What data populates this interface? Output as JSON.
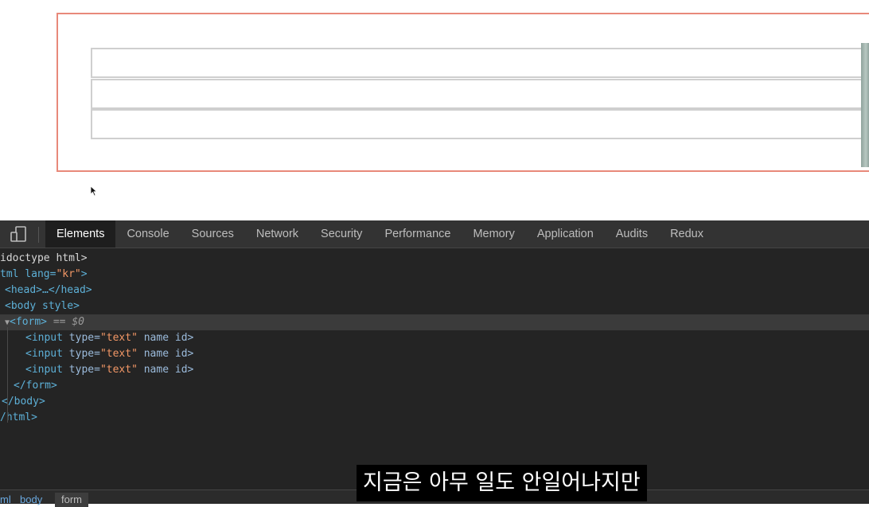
{
  "devtools": {
    "tabs": [
      "Elements",
      "Console",
      "Sources",
      "Network",
      "Security",
      "Performance",
      "Memory",
      "Application",
      "Audits",
      "Redux"
    ],
    "active_tab": "Elements",
    "dom": {
      "doctype": "idoctype html>",
      "html_open": "tml lang=",
      "html_lang": "\"kr\"",
      "html_open_end": ">",
      "head": "<head>…</head>",
      "body_open": "<body style>",
      "form_open": "<form>",
      "selected_marker": " == $0",
      "input_tag": "<input ",
      "input_type_attr": "type=",
      "input_type_val": "\"text\"",
      "input_rest": " name id>",
      "form_close": "</form>",
      "body_close": "</body>",
      "html_close": "/html>"
    },
    "breadcrumbs": [
      "ml",
      "body",
      "form"
    ]
  },
  "subtitle": "지금은 아무 일도 안일어나지만",
  "colors": {
    "form_border": "#e8897a",
    "input_border": "#cfcfcf",
    "devtools_bg": "#242424",
    "tag": "#5db0d7",
    "attr_value": "#f29766"
  }
}
